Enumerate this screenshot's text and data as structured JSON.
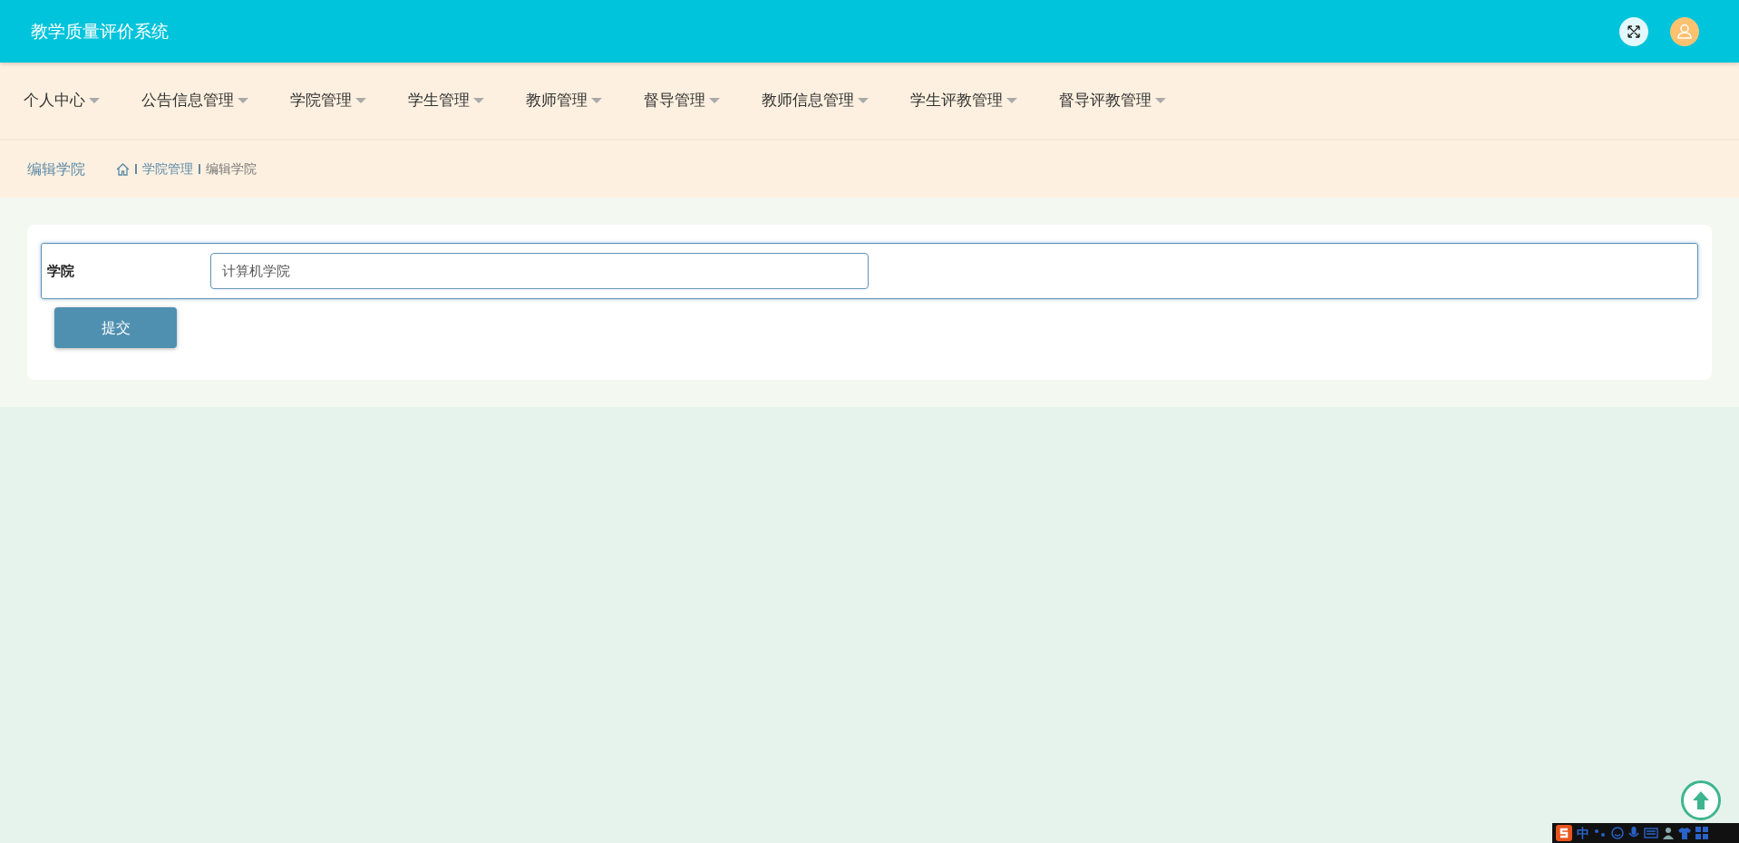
{
  "header": {
    "title": "教学质量评价系统"
  },
  "nav": [
    {
      "label": "个人中心"
    },
    {
      "label": "公告信息管理"
    },
    {
      "label": "学院管理"
    },
    {
      "label": "学生管理"
    },
    {
      "label": "教师管理"
    },
    {
      "label": "督导管理"
    },
    {
      "label": "教师信息管理"
    },
    {
      "label": "学生评教管理"
    },
    {
      "label": "督导评教管理"
    }
  ],
  "page_title": "编辑学院",
  "breadcrumb": [
    {
      "label": "学院管理",
      "kind": "link"
    },
    {
      "label": "编辑学院",
      "kind": "current"
    }
  ],
  "form": {
    "fields": [
      {
        "label": "学院",
        "value": "计算机学院"
      }
    ],
    "submit": "提交"
  },
  "ime_toolbar": {
    "mode": "中"
  }
}
